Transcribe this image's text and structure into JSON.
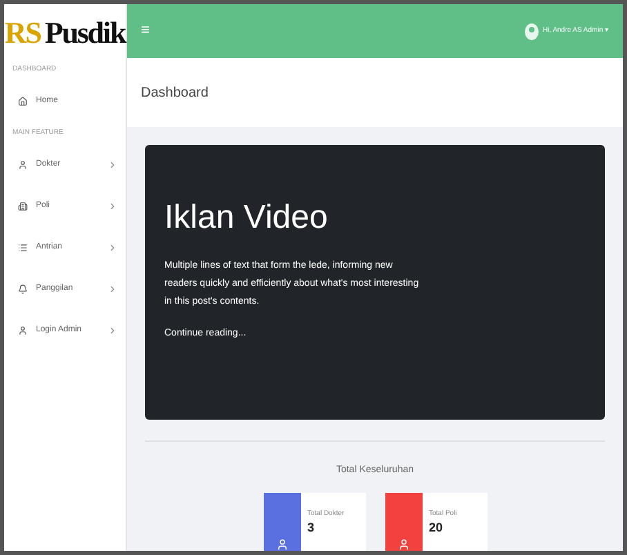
{
  "brand": {
    "mark": "RS",
    "name": "Pusdik"
  },
  "sidebar": {
    "sections": [
      {
        "heading": "DASHBOARD",
        "items": [
          {
            "label": "Home",
            "chevron": false
          }
        ]
      },
      {
        "heading": "MAIN FEATURE",
        "items": [
          {
            "label": "Dokter",
            "chevron": true
          },
          {
            "label": "Poli",
            "chevron": true
          },
          {
            "label": "Antrian",
            "chevron": true
          },
          {
            "label": "Panggilan",
            "chevron": true
          },
          {
            "label": "Login Admin",
            "chevron": true
          }
        ]
      }
    ]
  },
  "topbar": {
    "menu_glyph": "≡",
    "user": "Hi, Andre AS Admin",
    "caret": "▾"
  },
  "header": {
    "title": "Dashboard"
  },
  "hero": {
    "title": "Iklan Video",
    "lede": "Multiple lines of text that form the lede, informing new readers quickly and efficiently about what's most interesting in this post's contents.",
    "link": "Continue reading..."
  },
  "summary": {
    "title": "Total Keseluruhan",
    "stats": [
      {
        "label": "Total Dokter",
        "value": "3",
        "color": "#5a6fe0"
      },
      {
        "label": "Total Poli",
        "value": "20",
        "color": "#f2413f"
      }
    ]
  }
}
